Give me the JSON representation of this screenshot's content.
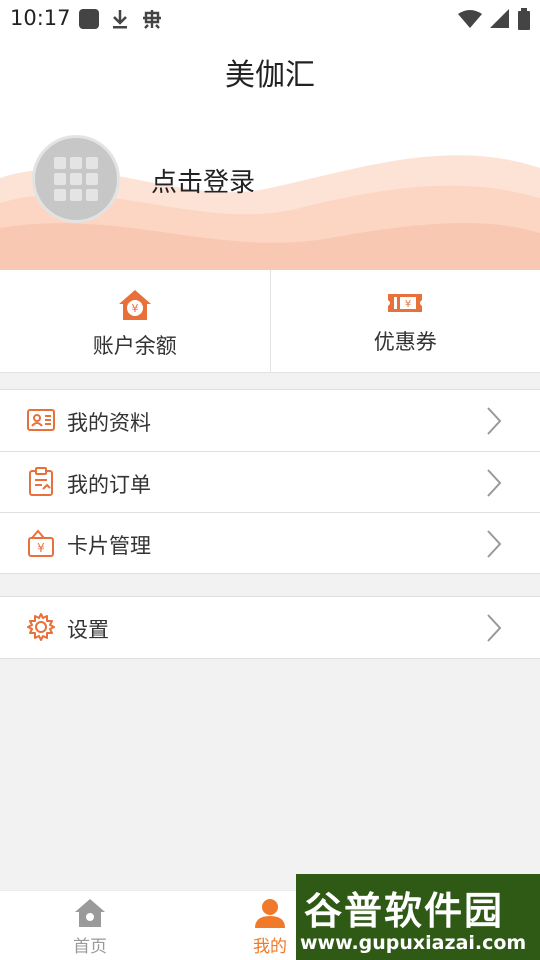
{
  "status_bar": {
    "time": "10:17"
  },
  "header": {
    "title": "美伽汇",
    "login_prompt": "点击登录"
  },
  "account": {
    "balance_label": "账户余额",
    "coupon_label": "优惠券"
  },
  "menu": {
    "profile_label": "我的资料",
    "orders_label": "我的订单",
    "cards_label": "卡片管理",
    "settings_label": "设置"
  },
  "tabbar": {
    "home_label": "首页",
    "mine_label": "我的"
  },
  "watermark": {
    "site_name": "谷普软件园",
    "url": "www.gupuxiazai.com"
  },
  "colors": {
    "accent": "#f07a2a",
    "icon_orange": "#e8703a",
    "inactive": "#9a9a9a",
    "wave": "#fbd7c6"
  },
  "icons": [
    "notification-square-icon",
    "download-icon",
    "bug-icon",
    "wifi-icon",
    "signal-icon",
    "battery-icon",
    "avatar-grid-icon",
    "wallet-house-icon",
    "ticket-icon",
    "profile-card-icon",
    "order-clipboard-icon",
    "card-manage-icon",
    "gear-icon",
    "chevron-right-icon",
    "home-icon",
    "person-icon"
  ]
}
